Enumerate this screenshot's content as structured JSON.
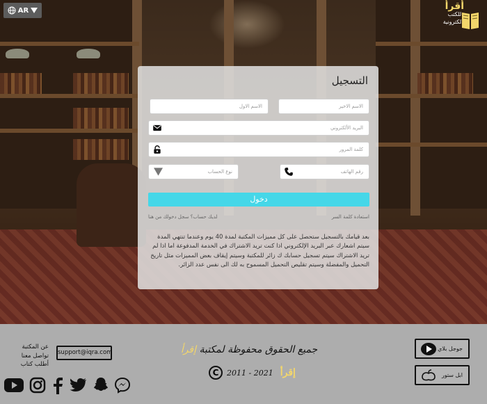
{
  "header": {
    "language": "AR",
    "logo": {
      "title": "أقرأ",
      "subtitle": "للكتب",
      "subtitle2": "الالكترونية"
    }
  },
  "form": {
    "title": "التسجيل",
    "fields": {
      "last_name": "الاسم الاخير",
      "first_name": "الاسم الاول",
      "email": "البريد الألكتروني",
      "password": "كلمة المرور",
      "phone": "رقم الهاتف",
      "account_type": "نوع الحساب"
    },
    "submit_label": "دخول",
    "forgot_password": "استعادة كلمة السر",
    "login_link": "لديك حساب؟ سجل دخولك من هنا",
    "terms": "بعد قيامك بالتسجيل ستحصل على كل مميزات المكتبة لمدة 40 يوم وعندما تنتهي المدة سيتم اشعارك عبر البريد الإلكتروني اذا كنت تريد الاشتراك في الخدمة المدفوعة اما اذا لم تريد الاشتراك سيتم تسجيل حسابك ك زائر للمكتبة وسيتم إيقاف بعض المميزات مثل تاريخ التحميل والمفضلة وسيتم تقليص التحميل المسموح به لك الى نفس عدد الزائر."
  },
  "footer": {
    "google_play": "جوجل بلاي",
    "app_store": "ابل ستور",
    "rights_text": "جميع الحقوق محفوظة لمكتبة",
    "rights_brand": "إقرأ",
    "years": "2011 - 2021",
    "brand": "إقرأ",
    "copyright_symbol": "C",
    "support_email": "support@iqra.com",
    "links": [
      "عن المكتبة",
      "تواصل معنا",
      "أطلب كتاب"
    ]
  },
  "colors": {
    "accent": "#45d7e8",
    "brand_gold": "#f3d66b",
    "footer_bg": "#adadad"
  },
  "icons": [
    "globe-icon",
    "chevron-down-icon",
    "open-book-icon",
    "email-icon",
    "lock-icon",
    "phone-icon",
    "youtube-icon",
    "instagram-icon",
    "facebook-icon",
    "twitter-icon",
    "snapchat-icon",
    "messenger-icon",
    "google-play-icon",
    "apple-icon"
  ]
}
